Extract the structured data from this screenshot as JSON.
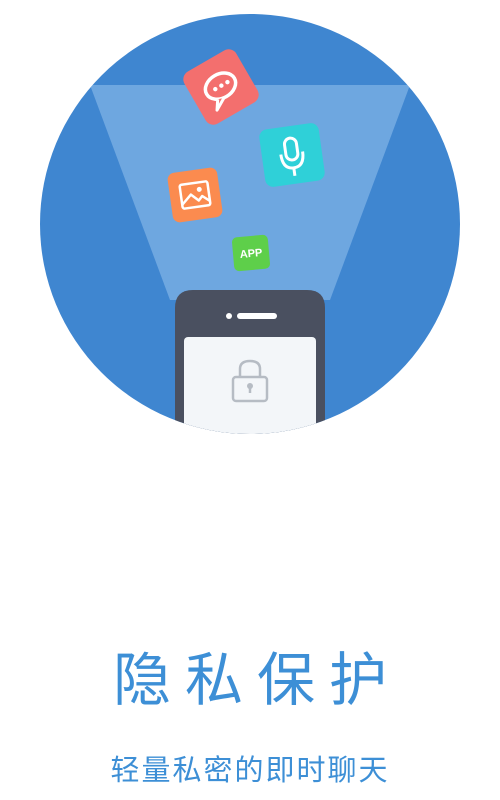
{
  "intro": {
    "title": "隐私保护",
    "subtitle": "轻量私密的即时聊天",
    "app_badge_label": "APP"
  },
  "icons": {
    "chat": "chat-bubble-icon",
    "mic": "microphone-icon",
    "picture": "picture-icon",
    "app": "app-icon",
    "lock": "lock-icon"
  },
  "colors": {
    "circle": "#3f86d0",
    "beam": "#7fb1e6",
    "phone": "#4a5060",
    "chat_tile": "#f36f6e",
    "mic_tile": "#2fd0d8",
    "picture_tile": "#fb8b4f",
    "app_tile": "#5ecf4a",
    "text": "#3d8fd6"
  }
}
